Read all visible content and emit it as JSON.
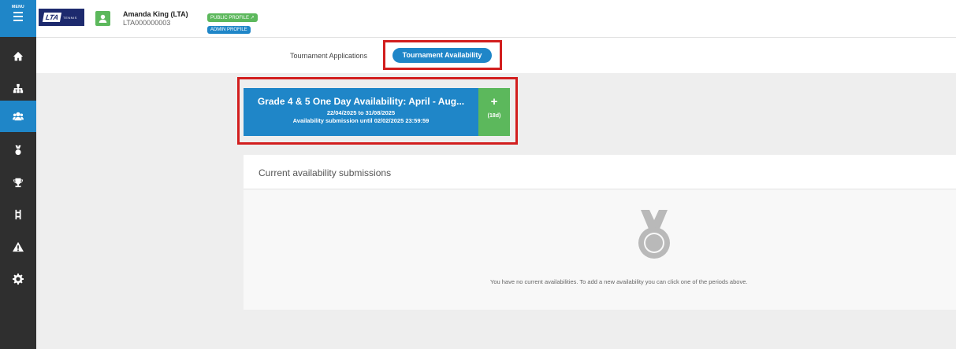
{
  "sidebar": {
    "menu_label": "MENU",
    "items": [
      {
        "icon": "home-icon"
      },
      {
        "icon": "sitemap-icon"
      },
      {
        "icon": "users-icon",
        "active": true
      },
      {
        "icon": "medal-icon"
      },
      {
        "icon": "trophy-icon"
      },
      {
        "icon": "ladder-icon"
      },
      {
        "icon": "warning-icon"
      },
      {
        "icon": "gear-icon"
      }
    ]
  },
  "header": {
    "logo_text": "LTA",
    "logo_sub": "TENNIS",
    "user_name": "Amanda King (LTA)",
    "user_id": "LTA000000003",
    "public_profile": "PUBLIC PROFILE ↗",
    "admin_profile": "ADMIN PROFILE"
  },
  "tabs": {
    "applications": "Tournament Applications",
    "availability": "Tournament Availability"
  },
  "card": {
    "title": "Grade 4 & 5 One Day Availability: April - Aug...",
    "dates": "22/04/2025 to 31/08/2025",
    "deadline": "Availability submission until 02/02/2025 23:59:59",
    "add_symbol": "+",
    "days_left": "(18d)"
  },
  "panel": {
    "title": "Current availability submissions",
    "empty_message": "You have no current availabilities. To add a new availability you can click one of the periods above."
  },
  "colors": {
    "primary": "#1f86c8",
    "success": "#5cb85c",
    "sidebar": "#2f2f2f",
    "highlight": "#d21e1e"
  }
}
